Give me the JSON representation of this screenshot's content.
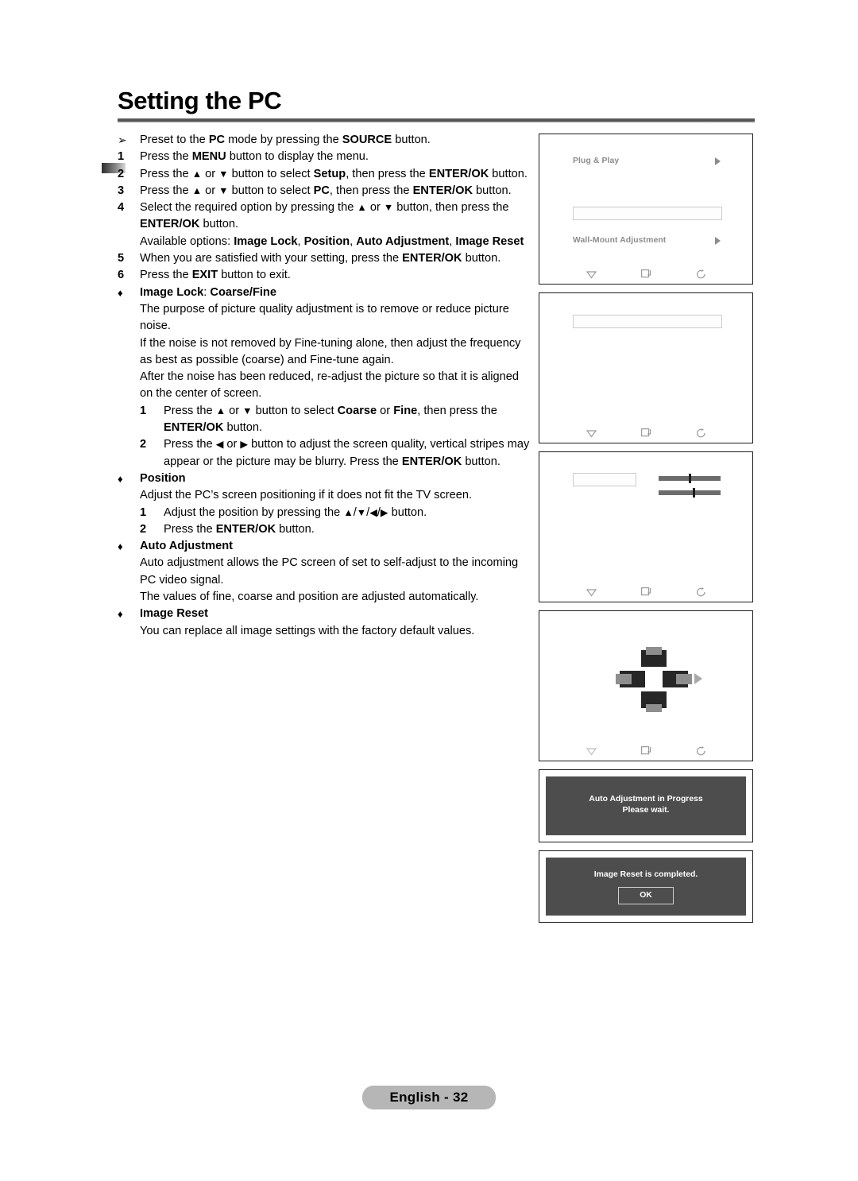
{
  "page": {
    "title": "Setting the PC",
    "footer_label": "English - 32"
  },
  "instructions": [
    {
      "marker": "➢",
      "marker_type": "arrow",
      "html": "Preset to the <b>PC</b> mode by pressing the <b>SOURCE</b> button."
    },
    {
      "marker": "1",
      "marker_type": "number",
      "html": "Press the <b>MENU</b> button to display the menu."
    },
    {
      "marker": "2",
      "marker_type": "number",
      "html": "Press the <span class=\"glyph\">▲</span> or <span class=\"glyph\">▼</span> button to select <b>Setup</b>, then press the <b>ENTER/OK</b> button."
    },
    {
      "marker": "3",
      "marker_type": "number",
      "html": "Press the <span class=\"glyph\">▲</span> or <span class=\"glyph\">▼</span> button to select <b>PC</b>, then press the <b>ENTER/OK</b> button."
    },
    {
      "marker": "4",
      "marker_type": "number",
      "html": "Select the required option by pressing the <span class=\"glyph\">▲</span> or <span class=\"glyph\">▼</span> button, then press the <b>ENTER/OK</b> button."
    },
    {
      "marker": "",
      "marker_type": "continuation",
      "html": "Available options: <b>Image Lock</b>, <b>Position</b>, <b>Auto Adjustment</b>, <b>Image Reset</b>"
    },
    {
      "marker": "5",
      "marker_type": "number",
      "html": "When you are satisfied with your setting, press the <b>ENTER/OK</b> button."
    },
    {
      "marker": "6",
      "marker_type": "number",
      "html": "Press the <b>EXIT</b> button to exit."
    },
    {
      "marker": "♦",
      "marker_type": "diamond",
      "html": "<b>Image Lock</b>: <b>Coarse/Fine</b>"
    },
    {
      "marker": "",
      "marker_type": "continuation",
      "html": "The purpose of picture quality adjustment is to remove or reduce picture noise."
    },
    {
      "marker": "",
      "marker_type": "continuation",
      "html": "If the noise is not removed by Fine-tuning alone, then adjust the frequency as best as possible (coarse) and Fine-tune again."
    },
    {
      "marker": "",
      "marker_type": "continuation",
      "html": "After the noise has been reduced, re-adjust the picture so that it is aligned on the center of screen."
    },
    {
      "marker": "1",
      "marker_type": "sub-number",
      "html": "Press the <span class=\"glyph\">▲</span> or <span class=\"glyph\">▼</span> button to select <b>Coarse</b> or <b>Fine</b>, then press the <b>ENTER/OK</b> button."
    },
    {
      "marker": "2",
      "marker_type": "sub-number",
      "html": "Press the <span class=\"glyph\">◀</span> or <span class=\"glyph\">▶</span> button to adjust the screen quality, vertical stripes may appear or the picture may be blurry. Press the <b>ENTER/OK</b> button."
    },
    {
      "marker": "♦",
      "marker_type": "diamond",
      "html": "<b>Position</b>"
    },
    {
      "marker": "",
      "marker_type": "continuation",
      "html": "Adjust the PC’s screen positioning if it does not fit the TV screen."
    },
    {
      "marker": "1",
      "marker_type": "sub-number",
      "html": "Adjust the position by pressing the <span class=\"glyph\">▲</span>/<span class=\"glyph\">▼</span>/<span class=\"glyph\">◀</span>/<span class=\"glyph\">▶</span> button."
    },
    {
      "marker": "2",
      "marker_type": "sub-number",
      "html": "Press the <b>ENTER/OK</b> button."
    },
    {
      "marker": "♦",
      "marker_type": "diamond",
      "html": "<b>Auto Adjustment</b>"
    },
    {
      "marker": "",
      "marker_type": "continuation",
      "html": "Auto adjustment allows the PC screen of set to self-adjust to the incoming PC video signal."
    },
    {
      "marker": "",
      "marker_type": "continuation",
      "html": "The values of fine, coarse and position are adjusted automatically."
    },
    {
      "marker": "♦",
      "marker_type": "diamond",
      "html": "<b>Image Reset</b>"
    },
    {
      "marker": "",
      "marker_type": "continuation",
      "html": "You can replace all image settings with the factory default values."
    }
  ],
  "screens": {
    "icon_strip": {
      "move_icon": "move-down-icon",
      "enter_icon": "enter-icon",
      "return_icon": "return-icon"
    },
    "screen1": {
      "name": "setup-menu-screen",
      "row1_label": "Plug & Play",
      "row2_label": "Wall-Mount Adjustment",
      "caret": "▶"
    },
    "screen2": {
      "name": "pc-menu-screen"
    },
    "screen3": {
      "name": "image-lock-screen",
      "slider1_percent": 50,
      "slider2_percent": 57
    },
    "screen4": {
      "name": "position-screen"
    }
  },
  "dialogs": {
    "auto_adjustment": {
      "line1": "Auto Adjustment in Progress",
      "line2": "Please wait."
    },
    "image_reset": {
      "line1": "Image Reset is completed.",
      "ok_label": "OK"
    }
  },
  "colors": {
    "osd_text": "#8c8c8c",
    "dialog_bg": "#4d4d4d",
    "rule": "#4a4a4a",
    "footer_pill": "#b6b6b6"
  }
}
